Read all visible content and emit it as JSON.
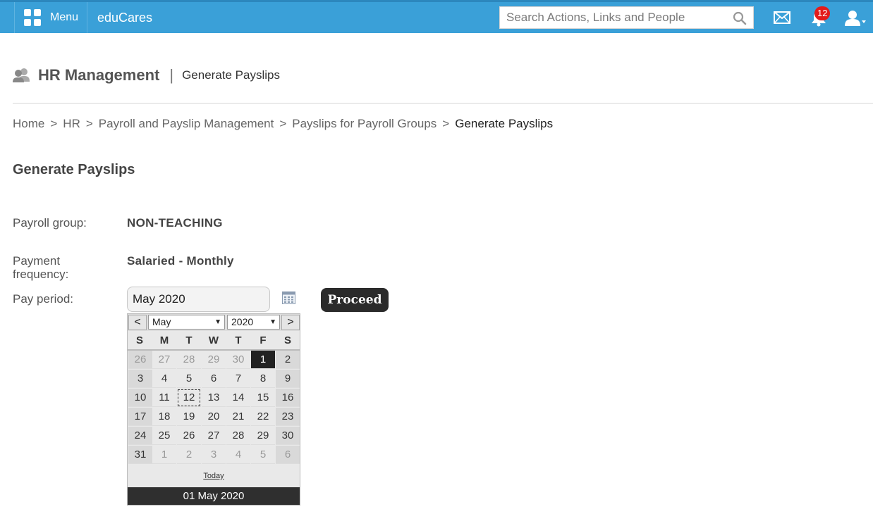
{
  "topbar": {
    "menu_label": "Menu",
    "brand": "eduCares",
    "search_placeholder": "Search Actions, Links and People",
    "notification_count": "12",
    "bg_color": "#3aa0d8"
  },
  "header": {
    "title": "HR Management",
    "separator": "|",
    "subtitle": "Generate Payslips"
  },
  "breadcrumb": {
    "items": [
      "Home",
      "HR",
      "Payroll and Payslip Management",
      "Payslips for Payroll Groups"
    ],
    "current": "Generate Payslips",
    "separator": ">"
  },
  "section_title": "Generate Payslips",
  "form": {
    "payroll_group_label": "Payroll group:",
    "payroll_group_value": "NON-TEACHING",
    "payment_frequency_label_1": "Payment",
    "payment_frequency_label_2": "frequency:",
    "payment_frequency_value": "Salaried - Monthly",
    "pay_period_label": "Pay period:",
    "pay_period_value": "May 2020",
    "proceed_label": "Proceed"
  },
  "calendar": {
    "prev": "<",
    "next": ">",
    "month": "May",
    "year": "2020",
    "weekdays": [
      "S",
      "M",
      "T",
      "W",
      "T",
      "F",
      "S"
    ],
    "weeks": [
      [
        "26",
        "27",
        "28",
        "29",
        "30",
        "1",
        "2"
      ],
      [
        "3",
        "4",
        "5",
        "6",
        "7",
        "8",
        "9"
      ],
      [
        "10",
        "11",
        "12",
        "13",
        "14",
        "15",
        "16"
      ],
      [
        "17",
        "18",
        "19",
        "20",
        "21",
        "22",
        "23"
      ],
      [
        "24",
        "25",
        "26",
        "27",
        "28",
        "29",
        "30"
      ],
      [
        "31",
        "1",
        "2",
        "3",
        "4",
        "5",
        "6"
      ]
    ],
    "selected_day": "1",
    "today_day": "12",
    "today_label": "Today",
    "footer": "01 May 2020"
  }
}
